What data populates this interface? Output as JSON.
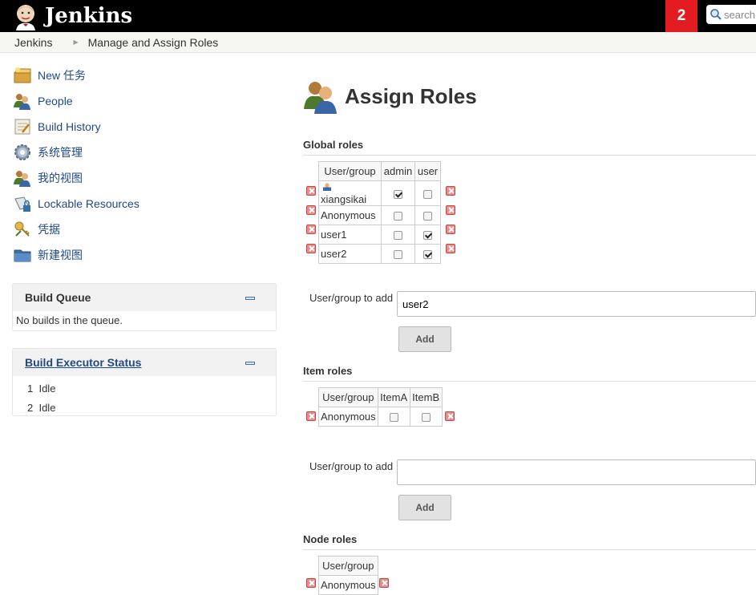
{
  "header": {
    "logo_text": "Jenkins",
    "notification_count": "2",
    "search_placeholder": "search"
  },
  "breadcrumb": [
    "Jenkins",
    "Manage and Assign Roles"
  ],
  "sidebar": {
    "tasks": [
      {
        "label": "New 任务",
        "icon": "new-item-icon"
      },
      {
        "label": "People",
        "icon": "people-icon"
      },
      {
        "label": "Build History",
        "icon": "build-history-icon"
      },
      {
        "label": "系统管理",
        "icon": "gear-icon"
      },
      {
        "label": "我的视图",
        "icon": "people-icon"
      },
      {
        "label": "Lockable Resources",
        "icon": "lockable-icon"
      },
      {
        "label": "凭据",
        "icon": "credentials-icon"
      },
      {
        "label": "新建视图",
        "icon": "folder-icon"
      }
    ],
    "build_queue": {
      "title": "Build Queue",
      "empty_text": "No builds in the queue."
    },
    "executors": {
      "title": "Build Executor Status",
      "rows": [
        {
          "num": "1",
          "status": "Idle"
        },
        {
          "num": "2",
          "status": "Idle"
        }
      ]
    }
  },
  "main": {
    "title": "Assign Roles",
    "global": {
      "title": "Global roles",
      "headers": [
        "User/group",
        "admin",
        "user"
      ],
      "rows": [
        {
          "name": "xiangsikai",
          "checks": [
            true,
            false
          ]
        },
        {
          "name": "Anonymous",
          "checks": [
            false,
            false
          ]
        },
        {
          "name": "user1",
          "checks": [
            false,
            true
          ]
        },
        {
          "name": "user2",
          "checks": [
            false,
            true
          ]
        }
      ],
      "add_label": "User/group to add",
      "add_value": "user2",
      "add_button": "Add"
    },
    "item": {
      "title": "Item roles",
      "headers": [
        "User/group",
        "ItemA",
        "ItemB"
      ],
      "rows": [
        {
          "name": "Anonymous",
          "checks": [
            false,
            false
          ]
        }
      ],
      "add_label": "User/group to add",
      "add_value": "",
      "add_button": "Add"
    },
    "node": {
      "title": "Node roles",
      "headers": [
        "User/group"
      ],
      "rows": [
        {
          "name": "Anonymous"
        }
      ]
    }
  },
  "colors": {
    "header_bg": "#000000",
    "notification_bg": "#e21c20",
    "link": "#204a87"
  }
}
